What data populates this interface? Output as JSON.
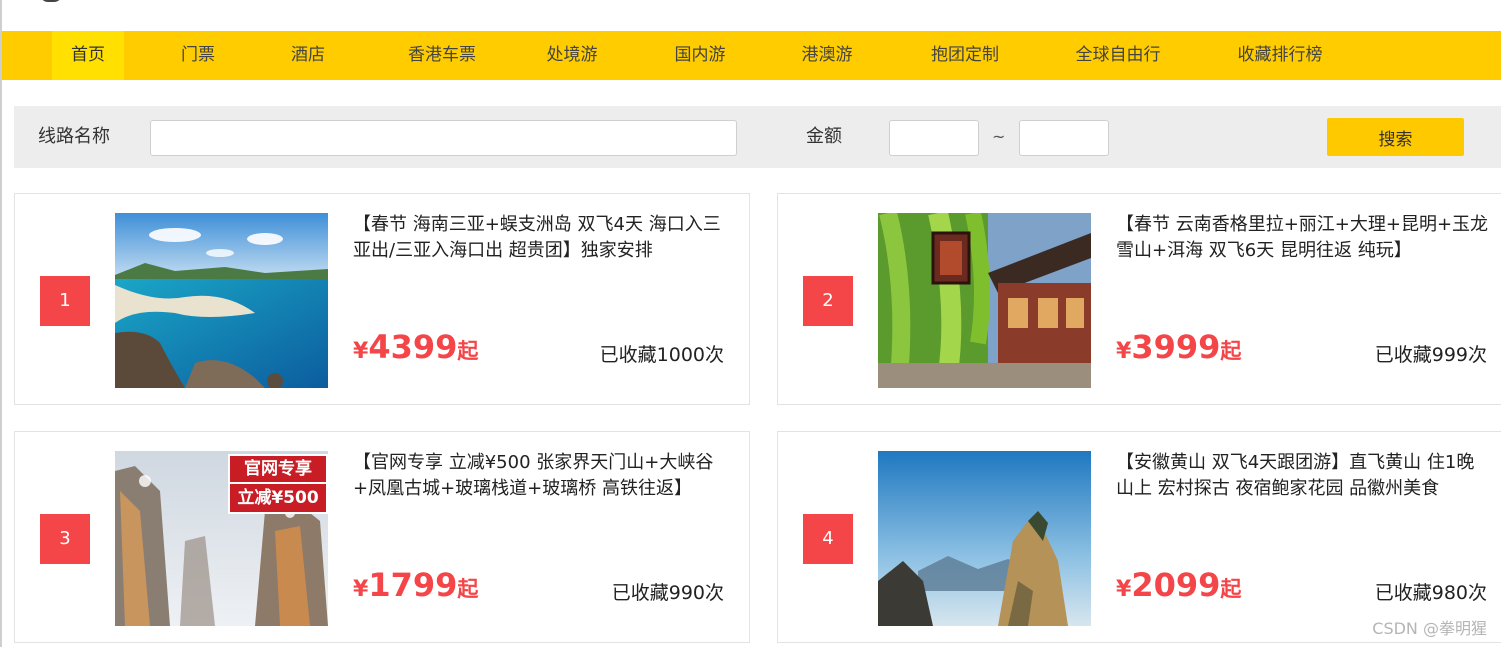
{
  "nav": {
    "items": [
      {
        "label": "首页",
        "active": true
      },
      {
        "label": "门票",
        "active": false
      },
      {
        "label": "酒店",
        "active": false
      },
      {
        "label": "香港车票",
        "active": false
      },
      {
        "label": "处境游",
        "active": false
      },
      {
        "label": "国内游",
        "active": false
      },
      {
        "label": "港澳游",
        "active": false
      },
      {
        "label": "抱团定制",
        "active": false
      },
      {
        "label": "全球自由行",
        "active": false
      },
      {
        "label": "收藏排行榜",
        "active": false
      }
    ]
  },
  "search": {
    "route_label": "线路名称",
    "route_value": "",
    "price_label": "金额",
    "min_value": "",
    "separator": "~",
    "max_value": "",
    "button_label": "搜索"
  },
  "routes": [
    {
      "rank": "1",
      "image": "sanya-beach-photo",
      "title": "【春节 海南三亚+蜈支洲岛 双飞4天 海口入三亚出/三亚入海口出 超贵团】独家安排",
      "currency": "¥",
      "price": "4399",
      "price_suffix": "起",
      "favorites": "已收藏1000次"
    },
    {
      "rank": "2",
      "image": "lijiang-old-town-photo",
      "title": "【春节 云南香格里拉+丽江+大理+昆明+玉龙雪山+洱海 双飞6天 昆明往返 纯玩】",
      "currency": "¥",
      "price": "3999",
      "price_suffix": "起",
      "favorites": "已收藏999次"
    },
    {
      "rank": "3",
      "image": "zhangjiajie-mountains-photo",
      "image_badge": [
        "官网专享",
        "立减¥500"
      ],
      "title": "【官网专享 立减¥500 张家界天门山+大峡谷+凤凰古城+玻璃栈道+玻璃桥 高铁往返】",
      "currency": "¥",
      "price": "1799",
      "price_suffix": "起",
      "favorites": "已收藏990次"
    },
    {
      "rank": "4",
      "image": "huangshan-peaks-photo",
      "title": "【安徽黄山 双飞4天跟团游】直飞黄山 住1晚山上 宏村探古 夜宿鲍家花园 品徽州美食",
      "currency": "¥",
      "price": "2099",
      "price_suffix": "起",
      "favorites": "已收藏980次"
    }
  ],
  "watermark": "CSDN @拳明猩",
  "colors": {
    "nav_bg": "#ffcc00",
    "nav_active": "#ffe000",
    "accent_red": "#f44548",
    "search_bg": "#ededed",
    "button_bg": "#ffc900"
  }
}
